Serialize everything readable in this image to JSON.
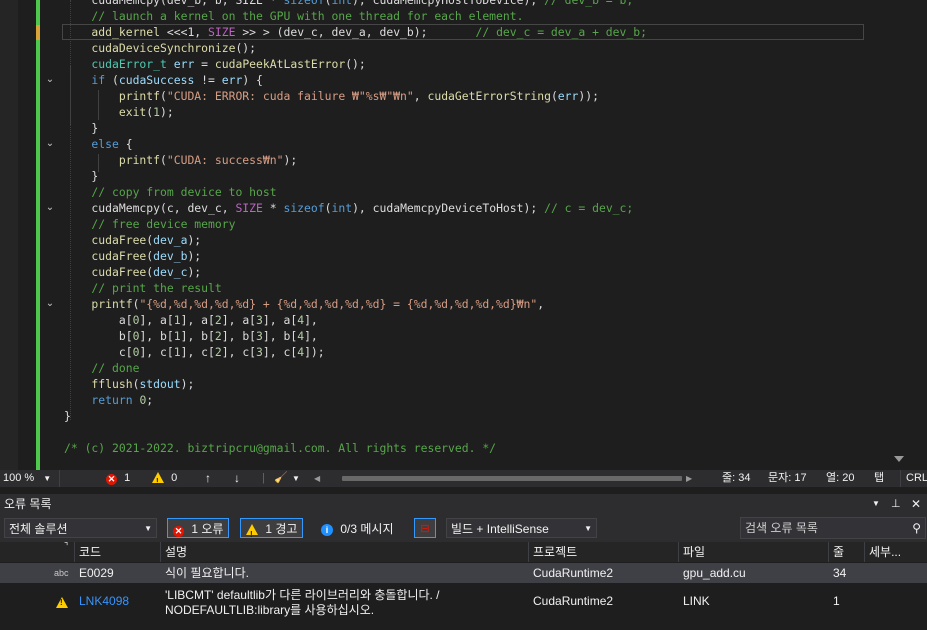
{
  "editor": {
    "lines": [
      {
        "fold": "",
        "tokens": [
          {
            "c": "c-pl",
            "t": "    cudaMemcpy(dev_b, b, SIZE * "
          },
          {
            "c": "c-kw",
            "t": "sizeof"
          },
          {
            "c": "c-pl",
            "t": "("
          },
          {
            "c": "c-kw",
            "t": "int"
          },
          {
            "c": "c-pl",
            "t": "), cudaMemcpyHostToDevice); "
          },
          {
            "c": "c-cm",
            "t": "// dev_b = b;"
          }
        ]
      },
      {
        "fold": "",
        "tokens": [
          {
            "c": "c-cm",
            "t": "    // launch a kernel on the GPU with one thread for each element."
          }
        ]
      },
      {
        "fold": "",
        "current": true,
        "tokens": [
          {
            "c": "c-fn",
            "t": "    add_kernel"
          },
          {
            "c": "c-pl",
            "t": " <<<1, "
          },
          {
            "c": "c-mac",
            "t": "SIZE"
          },
          {
            "c": "c-pl",
            "t": " >> > (dev_c, dev_a, dev_b);       "
          },
          {
            "c": "c-cm",
            "t": "// dev_c = dev_a + dev_b;"
          }
        ]
      },
      {
        "fold": "",
        "tokens": [
          {
            "c": "c-fn",
            "t": "    cudaDeviceSynchronize"
          },
          {
            "c": "c-pl",
            "t": "();"
          }
        ]
      },
      {
        "fold": "",
        "tokens": [
          {
            "c": "c-ty",
            "t": "    cudaError_t"
          },
          {
            "c": "c-pl",
            "t": " "
          },
          {
            "c": "c-id",
            "t": "err"
          },
          {
            "c": "c-pl",
            "t": " = "
          },
          {
            "c": "c-fn",
            "t": "cudaPeekAtLastError"
          },
          {
            "c": "c-pl",
            "t": "();"
          }
        ]
      },
      {
        "fold": "v",
        "tokens": [
          {
            "c": "c-kw",
            "t": "    if"
          },
          {
            "c": "c-pl",
            "t": " ("
          },
          {
            "c": "c-id",
            "t": "cudaSuccess"
          },
          {
            "c": "c-pl",
            "t": " != "
          },
          {
            "c": "c-id",
            "t": "err"
          },
          {
            "c": "c-pl",
            "t": ") {"
          }
        ]
      },
      {
        "fold": "",
        "tokens": [
          {
            "c": "c-fn",
            "t": "        printf"
          },
          {
            "c": "c-pl",
            "t": "("
          },
          {
            "c": "c-str",
            "t": "\"CUDA: ERROR: cuda failure ₩\"%s₩\"₩n\""
          },
          {
            "c": "c-pl",
            "t": ", "
          },
          {
            "c": "c-fn",
            "t": "cudaGetErrorString"
          },
          {
            "c": "c-pl",
            "t": "("
          },
          {
            "c": "c-id",
            "t": "err"
          },
          {
            "c": "c-pl",
            "t": "));"
          }
        ]
      },
      {
        "fold": "",
        "tokens": [
          {
            "c": "c-fn",
            "t": "        exit"
          },
          {
            "c": "c-pl",
            "t": "("
          },
          {
            "c": "c-num",
            "t": "1"
          },
          {
            "c": "c-pl",
            "t": ");"
          }
        ]
      },
      {
        "fold": "",
        "tokens": [
          {
            "c": "c-pl",
            "t": "    }"
          }
        ]
      },
      {
        "fold": "v",
        "tokens": [
          {
            "c": "c-kw",
            "t": "    else"
          },
          {
            "c": "c-pl",
            "t": " {"
          }
        ]
      },
      {
        "fold": "",
        "tokens": [
          {
            "c": "c-fn",
            "t": "        printf"
          },
          {
            "c": "c-pl",
            "t": "("
          },
          {
            "c": "c-str",
            "t": "\"CUDA: success₩n\""
          },
          {
            "c": "c-pl",
            "t": ");"
          }
        ]
      },
      {
        "fold": "",
        "tokens": [
          {
            "c": "c-pl",
            "t": "    }"
          }
        ]
      },
      {
        "fold": "",
        "tokens": [
          {
            "c": "c-cm",
            "t": "    // copy from device to host"
          }
        ]
      },
      {
        "fold": "v",
        "tokens": [
          {
            "c": "c-pl",
            "t": "    cudaMemcpy(c, dev_c, "
          },
          {
            "c": "c-mac",
            "t": "SIZE"
          },
          {
            "c": "c-pl",
            "t": " * "
          },
          {
            "c": "c-kw",
            "t": "sizeof"
          },
          {
            "c": "c-pl",
            "t": "("
          },
          {
            "c": "c-kw",
            "t": "int"
          },
          {
            "c": "c-pl",
            "t": "), cudaMemcpyDeviceToHost); "
          },
          {
            "c": "c-cm",
            "t": "// c = dev_c;"
          }
        ]
      },
      {
        "fold": "",
        "tokens": [
          {
            "c": "c-cm",
            "t": "    // free device memory"
          }
        ]
      },
      {
        "fold": "",
        "tokens": [
          {
            "c": "c-fn",
            "t": "    cudaFree"
          },
          {
            "c": "c-pl",
            "t": "("
          },
          {
            "c": "c-id",
            "t": "dev_a"
          },
          {
            "c": "c-pl",
            "t": ");"
          }
        ]
      },
      {
        "fold": "",
        "tokens": [
          {
            "c": "c-fn",
            "t": "    cudaFree"
          },
          {
            "c": "c-pl",
            "t": "("
          },
          {
            "c": "c-id",
            "t": "dev_b"
          },
          {
            "c": "c-pl",
            "t": ");"
          }
        ]
      },
      {
        "fold": "",
        "tokens": [
          {
            "c": "c-fn",
            "t": "    cudaFree"
          },
          {
            "c": "c-pl",
            "t": "("
          },
          {
            "c": "c-id",
            "t": "dev_c"
          },
          {
            "c": "c-pl",
            "t": ");"
          }
        ]
      },
      {
        "fold": "",
        "tokens": [
          {
            "c": "c-cm",
            "t": "    // print the result"
          }
        ]
      },
      {
        "fold": "v",
        "tokens": [
          {
            "c": "c-fn",
            "t": "    printf"
          },
          {
            "c": "c-pl",
            "t": "("
          },
          {
            "c": "c-str",
            "t": "\"{%d,%d,%d,%d,%d} + {%d,%d,%d,%d,%d} = {%d,%d,%d,%d,%d}₩n\""
          },
          {
            "c": "c-pl",
            "t": ","
          }
        ]
      },
      {
        "fold": "",
        "tokens": [
          {
            "c": "c-pl",
            "t": "        a["
          },
          {
            "c": "c-num",
            "t": "0"
          },
          {
            "c": "c-pl",
            "t": "], a["
          },
          {
            "c": "c-num",
            "t": "1"
          },
          {
            "c": "c-pl",
            "t": "], a["
          },
          {
            "c": "c-num",
            "t": "2"
          },
          {
            "c": "c-pl",
            "t": "], a["
          },
          {
            "c": "c-num",
            "t": "3"
          },
          {
            "c": "c-pl",
            "t": "], a["
          },
          {
            "c": "c-num",
            "t": "4"
          },
          {
            "c": "c-pl",
            "t": "],"
          }
        ]
      },
      {
        "fold": "",
        "tokens": [
          {
            "c": "c-pl",
            "t": "        b["
          },
          {
            "c": "c-num",
            "t": "0"
          },
          {
            "c": "c-pl",
            "t": "], b["
          },
          {
            "c": "c-num",
            "t": "1"
          },
          {
            "c": "c-pl",
            "t": "], b["
          },
          {
            "c": "c-num",
            "t": "2"
          },
          {
            "c": "c-pl",
            "t": "], b["
          },
          {
            "c": "c-num",
            "t": "3"
          },
          {
            "c": "c-pl",
            "t": "], b["
          },
          {
            "c": "c-num",
            "t": "4"
          },
          {
            "c": "c-pl",
            "t": "],"
          }
        ]
      },
      {
        "fold": "",
        "tokens": [
          {
            "c": "c-pl",
            "t": "        c["
          },
          {
            "c": "c-num",
            "t": "0"
          },
          {
            "c": "c-pl",
            "t": "], c["
          },
          {
            "c": "c-num",
            "t": "1"
          },
          {
            "c": "c-pl",
            "t": "], c["
          },
          {
            "c": "c-num",
            "t": "2"
          },
          {
            "c": "c-pl",
            "t": "], c["
          },
          {
            "c": "c-num",
            "t": "3"
          },
          {
            "c": "c-pl",
            "t": "], c["
          },
          {
            "c": "c-num",
            "t": "4"
          },
          {
            "c": "c-pl",
            "t": "]);"
          }
        ]
      },
      {
        "fold": "",
        "tokens": [
          {
            "c": "c-cm",
            "t": "    // done"
          }
        ]
      },
      {
        "fold": "",
        "tokens": [
          {
            "c": "c-fn",
            "t": "    fflush"
          },
          {
            "c": "c-pl",
            "t": "("
          },
          {
            "c": "c-id",
            "t": "stdout"
          },
          {
            "c": "c-pl",
            "t": ");"
          }
        ]
      },
      {
        "fold": "",
        "tokens": [
          {
            "c": "c-kw",
            "t": "    return"
          },
          {
            "c": "c-pl",
            "t": " "
          },
          {
            "c": "c-num",
            "t": "0"
          },
          {
            "c": "c-pl",
            "t": ";"
          }
        ]
      },
      {
        "fold": "",
        "tokens": [
          {
            "c": "c-pl",
            "t": "}"
          }
        ]
      },
      {
        "fold": "",
        "tokens": [
          {
            "c": "c-pl",
            "t": ""
          }
        ]
      },
      {
        "fold": "",
        "tokens": [
          {
            "c": "c-cm",
            "t": "/* (c) 2021-2022. biztripcru@gmail.com. All rights reserved. */"
          }
        ]
      }
    ]
  },
  "status": {
    "zoom": "100 %",
    "errors": "1",
    "warnings": "0",
    "line": "줄: 34",
    "col": "문자: 17",
    "col2": "열: 20",
    "tab": "탭",
    "eol": "CRLF"
  },
  "error_list": {
    "title": "오류 목록",
    "scope": "전체 솔루션",
    "errors_btn": "1 오류",
    "warnings_btn": "1 경고",
    "messages_btn": "0/3 메시지",
    "build_filter": "빌드 + IntelliSense",
    "search_placeholder": "검색 오류 목록",
    "columns": {
      "code": "코드",
      "desc": "설명",
      "project": "프로젝트",
      "file": "파일",
      "line": "줄",
      "detail": "세부..."
    },
    "rows": [
      {
        "icon": "abc",
        "code": "E0029",
        "desc": "식이 필요합니다.",
        "project": "CudaRuntime2",
        "file": "gpu_add.cu",
        "line": "34"
      },
      {
        "icon": "warn",
        "code": "LNK4098",
        "desc1": "'LIBCMT' defaultlib가 다른 라이브러리와 충돌합니다. /",
        "desc2": "NODEFAULTLIB:library를 사용하십시오.",
        "project": "CudaRuntime2",
        "file": "LINK",
        "line": "1"
      }
    ]
  }
}
